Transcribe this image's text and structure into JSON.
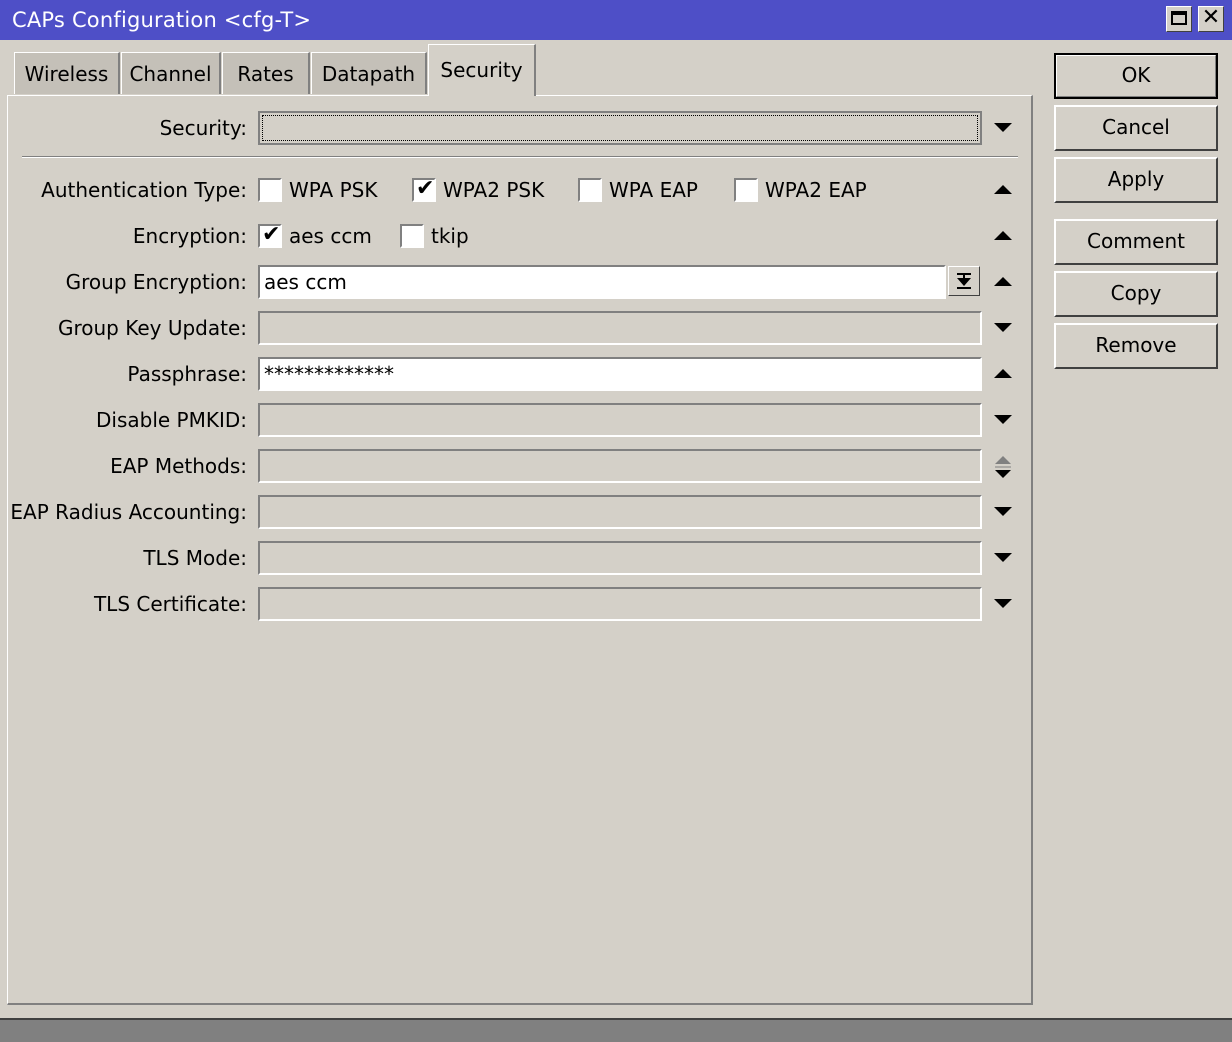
{
  "window": {
    "title": "CAPs Configuration <cfg-T>",
    "maximize_icon": "maximize-icon",
    "close_icon": "close-icon",
    "title_bar_color": "#4e4fc7"
  },
  "tabs": [
    {
      "label": "Wireless"
    },
    {
      "label": "Channel"
    },
    {
      "label": "Rates"
    },
    {
      "label": "Datapath"
    },
    {
      "label": "Security",
      "active": true
    }
  ],
  "buttons": {
    "ok": "OK",
    "cancel": "Cancel",
    "apply": "Apply",
    "comment": "Comment",
    "copy": "Copy",
    "remove": "Remove"
  },
  "form": {
    "security": {
      "label": "Security:",
      "value": ""
    },
    "auth_type": {
      "label": "Authentication Type:",
      "options": [
        {
          "label": "WPA PSK",
          "checked": false
        },
        {
          "label": "WPA2 PSK",
          "checked": true
        },
        {
          "label": "WPA EAP",
          "checked": false
        },
        {
          "label": "WPA2 EAP",
          "checked": false
        }
      ]
    },
    "encryption": {
      "label": "Encryption:",
      "options": [
        {
          "label": "aes ccm",
          "checked": true
        },
        {
          "label": "tkip",
          "checked": false
        }
      ]
    },
    "group_encryption": {
      "label": "Group Encryption:",
      "value": "aes ccm"
    },
    "group_key_update": {
      "label": "Group Key Update:",
      "value": ""
    },
    "passphrase": {
      "label": "Passphrase:",
      "value": "*************"
    },
    "disable_pmkid": {
      "label": "Disable PMKID:",
      "value": ""
    },
    "eap_methods": {
      "label": "EAP Methods:",
      "value": ""
    },
    "eap_radius_accounting": {
      "label": "EAP Radius Accounting:",
      "value": ""
    },
    "tls_mode": {
      "label": "TLS Mode:",
      "value": ""
    },
    "tls_certificate": {
      "label": "TLS Certificate:",
      "value": ""
    }
  },
  "check_mark": "✔"
}
